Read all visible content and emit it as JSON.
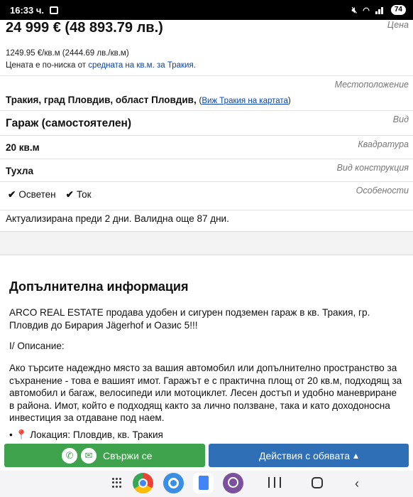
{
  "status_bar": {
    "time": "16:33 ч.",
    "battery": "74"
  },
  "listing": {
    "price": "24 999 € (48 893.79 лв.)",
    "price_label": "Цена",
    "price_per_sqm": "1249.95 €/кв.м (2444.69 лв./кв.м)",
    "price_note_prefix": "Цената е по-ниска от ",
    "price_note_link": "средната на кв.м. за Тракия.",
    "location_label": "Местоположение",
    "location": "Тракия, град Пловдив, област Пловдив,",
    "map_link_open": "(",
    "map_link": "Виж Тракия на картата",
    "map_link_close": ")",
    "type_label": "Вид",
    "type": "Гараж (самостоятелен)",
    "area_label": "Квадратура",
    "area": "20 кв.м",
    "construction_label": "Вид конструкция",
    "construction": "Тухла",
    "features_label": "Особености",
    "features": [
      "Осветен",
      "Ток"
    ],
    "updated": "Актуализирана преди 2 дни. Валидна още 87 дни."
  },
  "description": {
    "heading": "Допълнителна информация",
    "p1": "ARCO REAL ESTATE продава удобен и сигурен подземен гараж в кв. Тракия, гр. Пловдив до Бирария Jägerhof и Оазис 5!!!",
    "p2": "I/ Описание:",
    "p3": "Ако търсите надеждно място за вашия автомобил или допълнително пространство за съхранение - това е вашият имот. Гаражът е с практична площ от 20 кв.м, подходящ за автомобил и багаж, велосипеди или мотоциклет. Лесен достъп и удобно маневриране в района. Имот, който е подходящ както за лично ползване, така и като доходоносна инвестиция за отдаване под наем.",
    "p4_bullet": "• ",
    "p4_pin": "📍",
    "p4": " Локация: Пловдив, кв. Тракия"
  },
  "actions": {
    "contact": "Свържи се",
    "listing_actions": "Действия с обявата",
    "arrow": "▴"
  }
}
